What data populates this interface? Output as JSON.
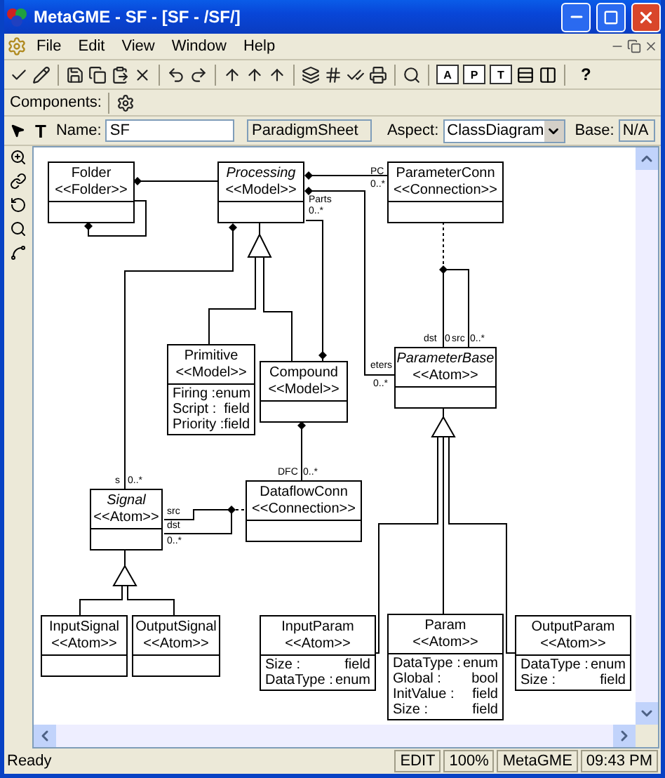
{
  "window": {
    "title": "MetaGME - SF - [SF - /SF/]"
  },
  "menu": [
    "File",
    "Edit",
    "View",
    "Window",
    "Help"
  ],
  "toolbar": {
    "aspect_buttons": [
      "A",
      "P",
      "T"
    ],
    "help_button": "?"
  },
  "components_bar": {
    "label": "Components:"
  },
  "object_bar": {
    "text_tool": "T",
    "name_label": "Name:",
    "name_value": "SF",
    "kind": "ParadigmSheet",
    "aspect_label": "Aspect:",
    "aspect_value": "ClassDiagram",
    "base_label": "Base:",
    "base_value": "N/A"
  },
  "diagram": {
    "classes": [
      {
        "name": "Folder",
        "stereotype": "<<Folder>>",
        "abstract": false
      },
      {
        "name": "Processing",
        "stereotype": "<<Model>>",
        "abstract": true
      },
      {
        "name": "ParameterConn",
        "stereotype": "<<Connection>>",
        "abstract": false
      },
      {
        "name": "Primitive",
        "stereotype": "<<Model>>",
        "abstract": false,
        "attributes": [
          {
            "name": "Firing :",
            "type": "enum"
          },
          {
            "name": "Script :",
            "type": "field"
          },
          {
            "name": "Priority :",
            "type": "field"
          }
        ]
      },
      {
        "name": "Compound",
        "stereotype": "<<Model>>",
        "abstract": false
      },
      {
        "name": "ParameterBase",
        "stereotype": "<<Atom>>",
        "abstract": true
      },
      {
        "name": "Signal",
        "stereotype": "<<Atom>>",
        "abstract": true
      },
      {
        "name": "DataflowConn",
        "stereotype": "<<Connection>>",
        "abstract": false
      },
      {
        "name": "InputSignal",
        "stereotype": "<<Atom>>",
        "abstract": false
      },
      {
        "name": "OutputSignal",
        "stereotype": "<<Atom>>",
        "abstract": false
      },
      {
        "name": "InputParam",
        "stereotype": "<<Atom>>",
        "abstract": false,
        "attributes": [
          {
            "name": "Size :",
            "type": "field"
          },
          {
            "name": "DataType :",
            "type": "enum"
          }
        ]
      },
      {
        "name": "Param",
        "stereotype": "<<Atom>>",
        "abstract": false,
        "attributes": [
          {
            "name": "DataType :",
            "type": "enum"
          },
          {
            "name": "Global :",
            "type": "bool"
          },
          {
            "name": "InitValue :",
            "type": "field"
          },
          {
            "name": "Size :",
            "type": "field"
          }
        ]
      },
      {
        "name": "OutputParam",
        "stereotype": "<<Atom>>",
        "abstract": false,
        "attributes": [
          {
            "name": "DataType :",
            "type": "enum"
          },
          {
            "name": "Size :",
            "type": "field"
          }
        ]
      }
    ],
    "role_labels": [
      "PC",
      "0..*",
      "Parts",
      "0..*",
      "eters",
      "0..*",
      "dst",
      "0",
      "src",
      "0..*",
      "DFC",
      "0..*",
      "s",
      "0..*",
      "src",
      "dst",
      "0..*"
    ]
  },
  "status_bar": {
    "message": "Ready",
    "panes": [
      "EDIT",
      "100%",
      "MetaGME",
      "09:43 PM"
    ]
  }
}
